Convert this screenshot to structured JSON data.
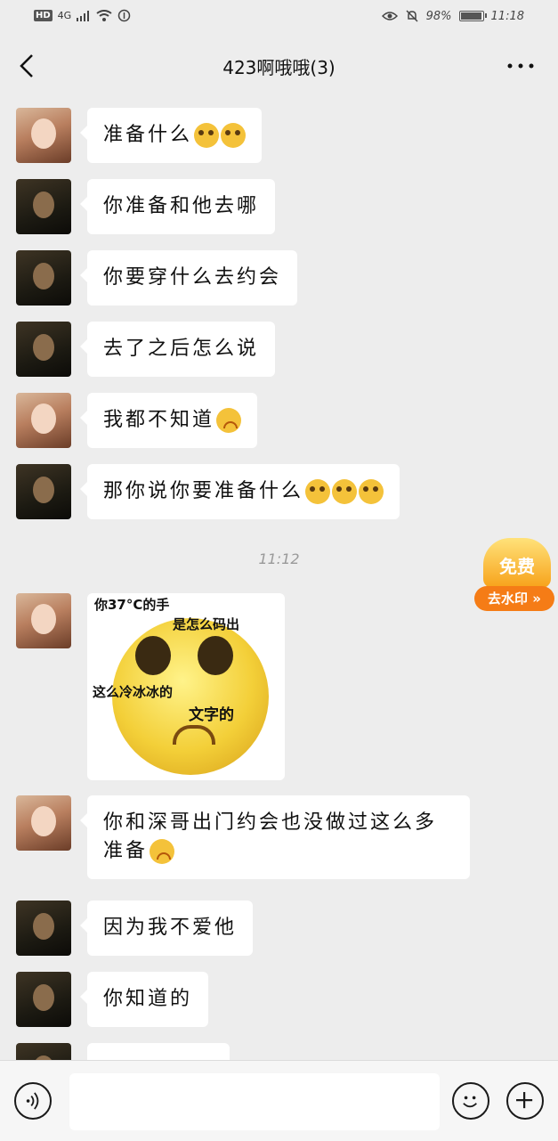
{
  "status_bar": {
    "network_hd": "HD",
    "network_4g": "4G",
    "battery_percent": "98%",
    "battery_level": 0.98,
    "time": "11:18"
  },
  "header": {
    "title": "423啊哦哦(3)"
  },
  "messages": [
    {
      "text": "准备什么",
      "emojis": [
        "puppy-eyes-emoji",
        "puppy-eyes-emoji"
      ],
      "avatar": "avatar-light"
    },
    {
      "text": "你准备和他去哪",
      "avatar": "avatar-dark"
    },
    {
      "text": "你要穿什么去约会",
      "avatar": "avatar-dark"
    },
    {
      "text": "去了之后怎么说",
      "avatar": "avatar-dark"
    },
    {
      "text": "我都不知道",
      "emojis": [
        "sad-emoji"
      ],
      "avatar": "avatar-light"
    },
    {
      "text": "那你说你要准备什么",
      "emojis": [
        "puzzled-emoji",
        "puzzled-emoji",
        "puzzled-emoji"
      ],
      "avatar": "avatar-dark"
    },
    {
      "text": "你和深哥出门约会也没做过这么多准备",
      "emojis": [
        "sad-emoji"
      ],
      "avatar": "avatar-light"
    },
    {
      "text": "因为我不爱他",
      "avatar": "avatar-dark"
    },
    {
      "text": "你知道的",
      "avatar": "avatar-dark"
    }
  ],
  "timestamp": "11:12",
  "sticker": {
    "line1": "你37°C的手",
    "line2": "是怎么码出",
    "line3": "这么冷冰冰的",
    "line4": "文字的"
  },
  "watermark_badge": {
    "top": "免费",
    "bottom": "去水印 »"
  },
  "input_bar": {
    "placeholder": ""
  }
}
